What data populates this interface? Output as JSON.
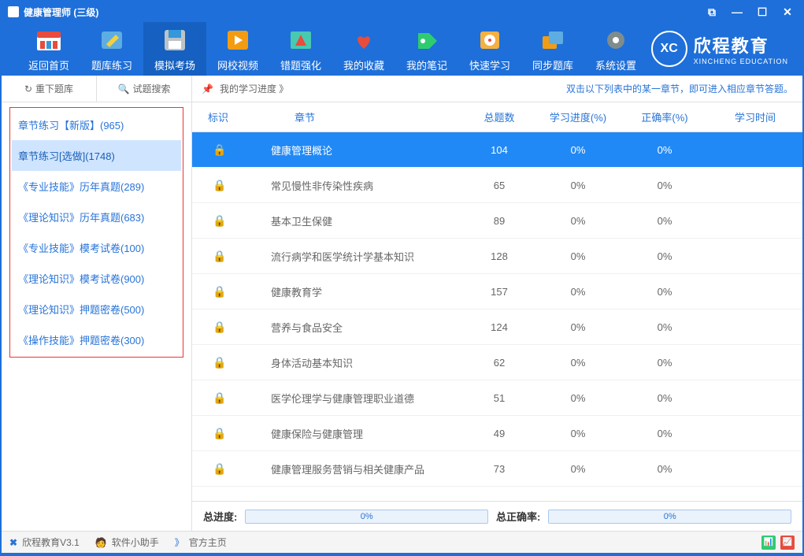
{
  "window": {
    "title": "健康管理师 (三级)"
  },
  "toolbar": {
    "items": [
      {
        "label": "返回首页",
        "icon": "home"
      },
      {
        "label": "题库练习",
        "icon": "pencil"
      },
      {
        "label": "模拟考场",
        "icon": "save"
      },
      {
        "label": "网校视频",
        "icon": "play"
      },
      {
        "label": "错题强化",
        "icon": "target"
      },
      {
        "label": "我的收藏",
        "icon": "heart"
      },
      {
        "label": "我的笔记",
        "icon": "tag"
      },
      {
        "label": "快速学习",
        "icon": "clock"
      },
      {
        "label": "同步题库",
        "icon": "sync"
      },
      {
        "label": "系统设置",
        "icon": "gear"
      }
    ]
  },
  "logo": {
    "abbr": "XC",
    "cn": "欣程教育",
    "en": "XINCHENG EDUCATION"
  },
  "sidebar": {
    "tabs": [
      {
        "label": "重下题库",
        "icon": "↻"
      },
      {
        "label": "试题搜索",
        "icon": "🔍"
      }
    ],
    "items": [
      {
        "label": "章节练习【新版】(965)"
      },
      {
        "label": "章节练习[选做](1748)"
      },
      {
        "label": "《专业技能》历年真题(289)"
      },
      {
        "label": "《理论知识》历年真题(683)"
      },
      {
        "label": "《专业技能》模考试卷(100)"
      },
      {
        "label": "《理论知识》模考试卷(900)"
      },
      {
        "label": "《理论知识》押题密卷(500)"
      },
      {
        "label": "《操作技能》押题密卷(300)"
      }
    ]
  },
  "content": {
    "progress_label": "我的学习进度 》",
    "hint": "双击以下列表中的某一章节，即可进入相应章节答题。",
    "columns": {
      "mark": "标识",
      "chapter": "章节",
      "total": "总题数",
      "progress": "学习进度(%)",
      "correct": "正确率(%)",
      "time": "学习时间"
    },
    "rows": [
      {
        "chapter": "健康管理概论",
        "total": "104",
        "progress": "0%",
        "correct": "0%"
      },
      {
        "chapter": "常见慢性非传染性疾病",
        "total": "65",
        "progress": "0%",
        "correct": "0%"
      },
      {
        "chapter": "基本卫生保健",
        "total": "89",
        "progress": "0%",
        "correct": "0%"
      },
      {
        "chapter": "流行病学和医学统计学基本知识",
        "total": "128",
        "progress": "0%",
        "correct": "0%"
      },
      {
        "chapter": "健康教育学",
        "total": "157",
        "progress": "0%",
        "correct": "0%"
      },
      {
        "chapter": "营养与食品安全",
        "total": "124",
        "progress": "0%",
        "correct": "0%"
      },
      {
        "chapter": "身体活动基本知识",
        "total": "62",
        "progress": "0%",
        "correct": "0%"
      },
      {
        "chapter": "医学伦理学与健康管理职业道德",
        "total": "51",
        "progress": "0%",
        "correct": "0%"
      },
      {
        "chapter": "健康保险与健康管理",
        "total": "49",
        "progress": "0%",
        "correct": "0%"
      },
      {
        "chapter": "健康管理服务营销与相关健康产品",
        "total": "73",
        "progress": "0%",
        "correct": "0%"
      }
    ],
    "footer": {
      "total_progress_label": "总进度:",
      "total_progress_value": "0%",
      "total_correct_label": "总正确率:",
      "total_correct_value": "0%"
    }
  },
  "statusbar": {
    "app": "欣程教育V3.1",
    "helper": "软件小助手",
    "home": "官方主页",
    "arrow": "》"
  }
}
